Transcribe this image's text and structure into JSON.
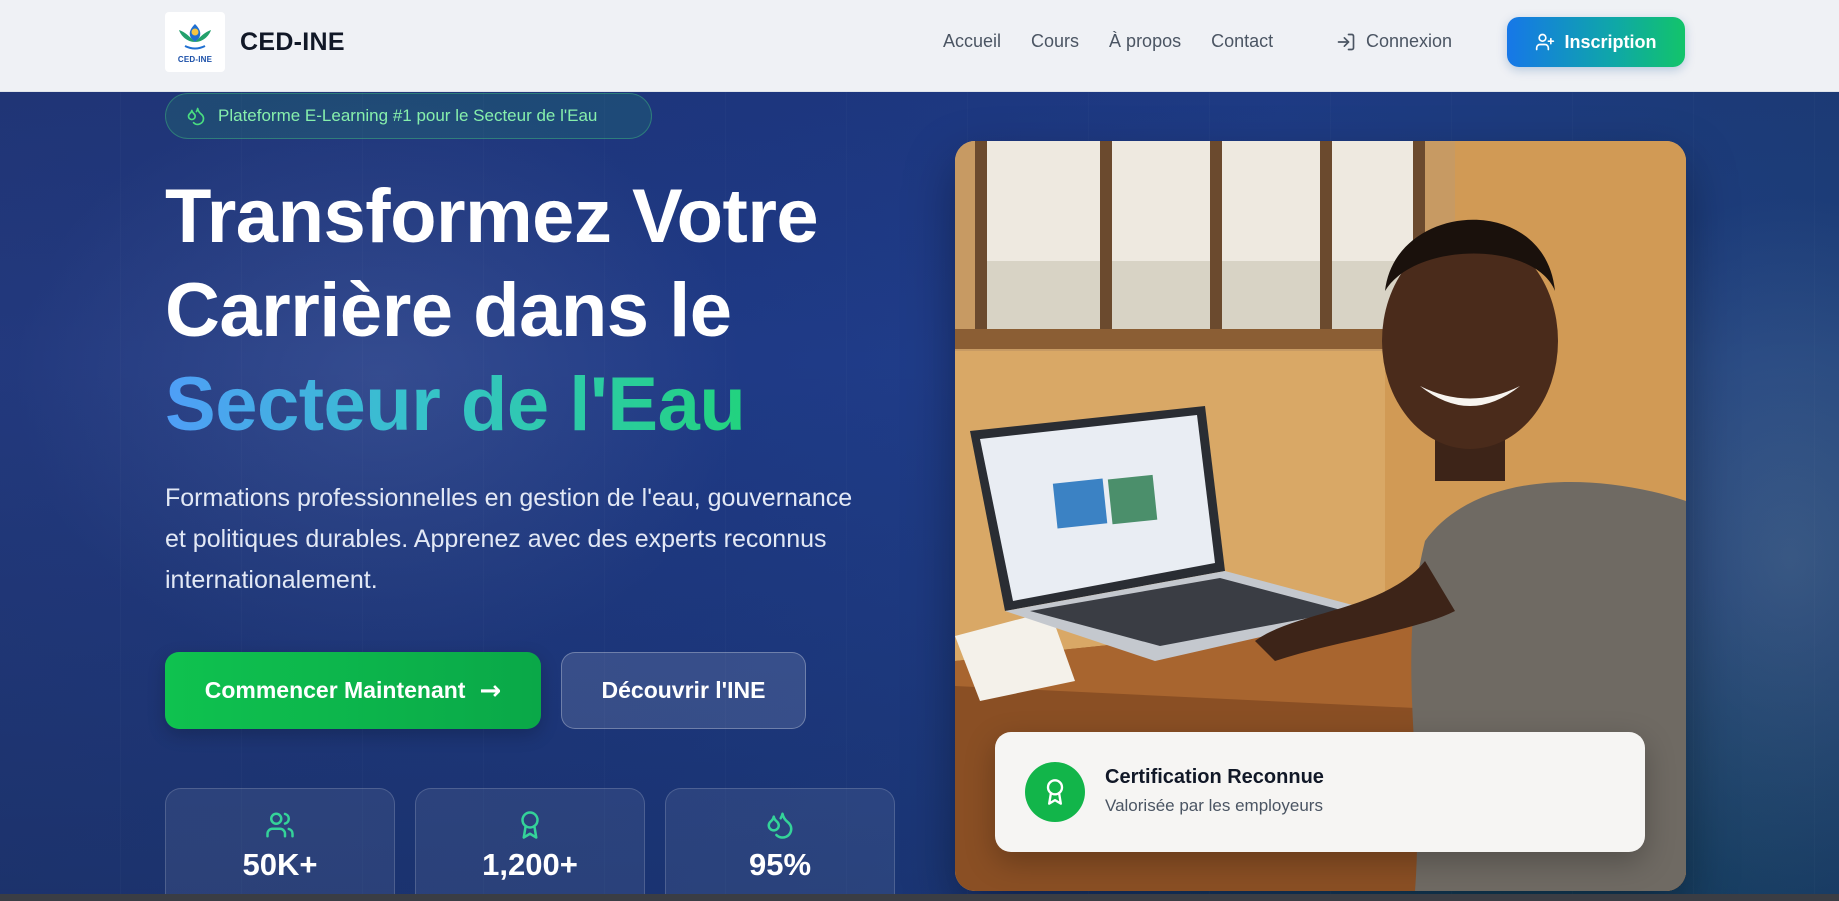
{
  "header": {
    "logo_text": "CED-INE",
    "brand": "CED-INE",
    "nav": [
      {
        "label": "Accueil"
      },
      {
        "label": "Cours"
      },
      {
        "label": "À propos"
      },
      {
        "label": "Contact"
      }
    ],
    "login_label": "Connexion",
    "signup_label": "Inscription"
  },
  "hero": {
    "badge": "Plateforme E-Learning #1 pour le Secteur de l'Eau",
    "title_line1": "Transformez Votre",
    "title_line2": "Carrière dans le",
    "title_line3": "Secteur de l'Eau",
    "lead": "Formations professionnelles en gestion de l'eau, gouvernance et politiques durables. Apprenez avec des experts reconnus internationalement.",
    "cta_primary": "Commencer Maintenant",
    "cta_primary_arrow": "→",
    "cta_secondary": "Découvrir l'INE",
    "stats": [
      {
        "icon": "users-icon",
        "value": "50K+"
      },
      {
        "icon": "award-icon",
        "value": "1,200+"
      },
      {
        "icon": "droplets-icon",
        "value": "95%"
      }
    ]
  },
  "card": {
    "title": "Certification Reconnue",
    "subtitle": "Valorisée par les employeurs"
  },
  "colors": {
    "accent_green": "#12b54a",
    "accent_blue": "#1677e8",
    "hero_bg": "#1f3a86"
  }
}
